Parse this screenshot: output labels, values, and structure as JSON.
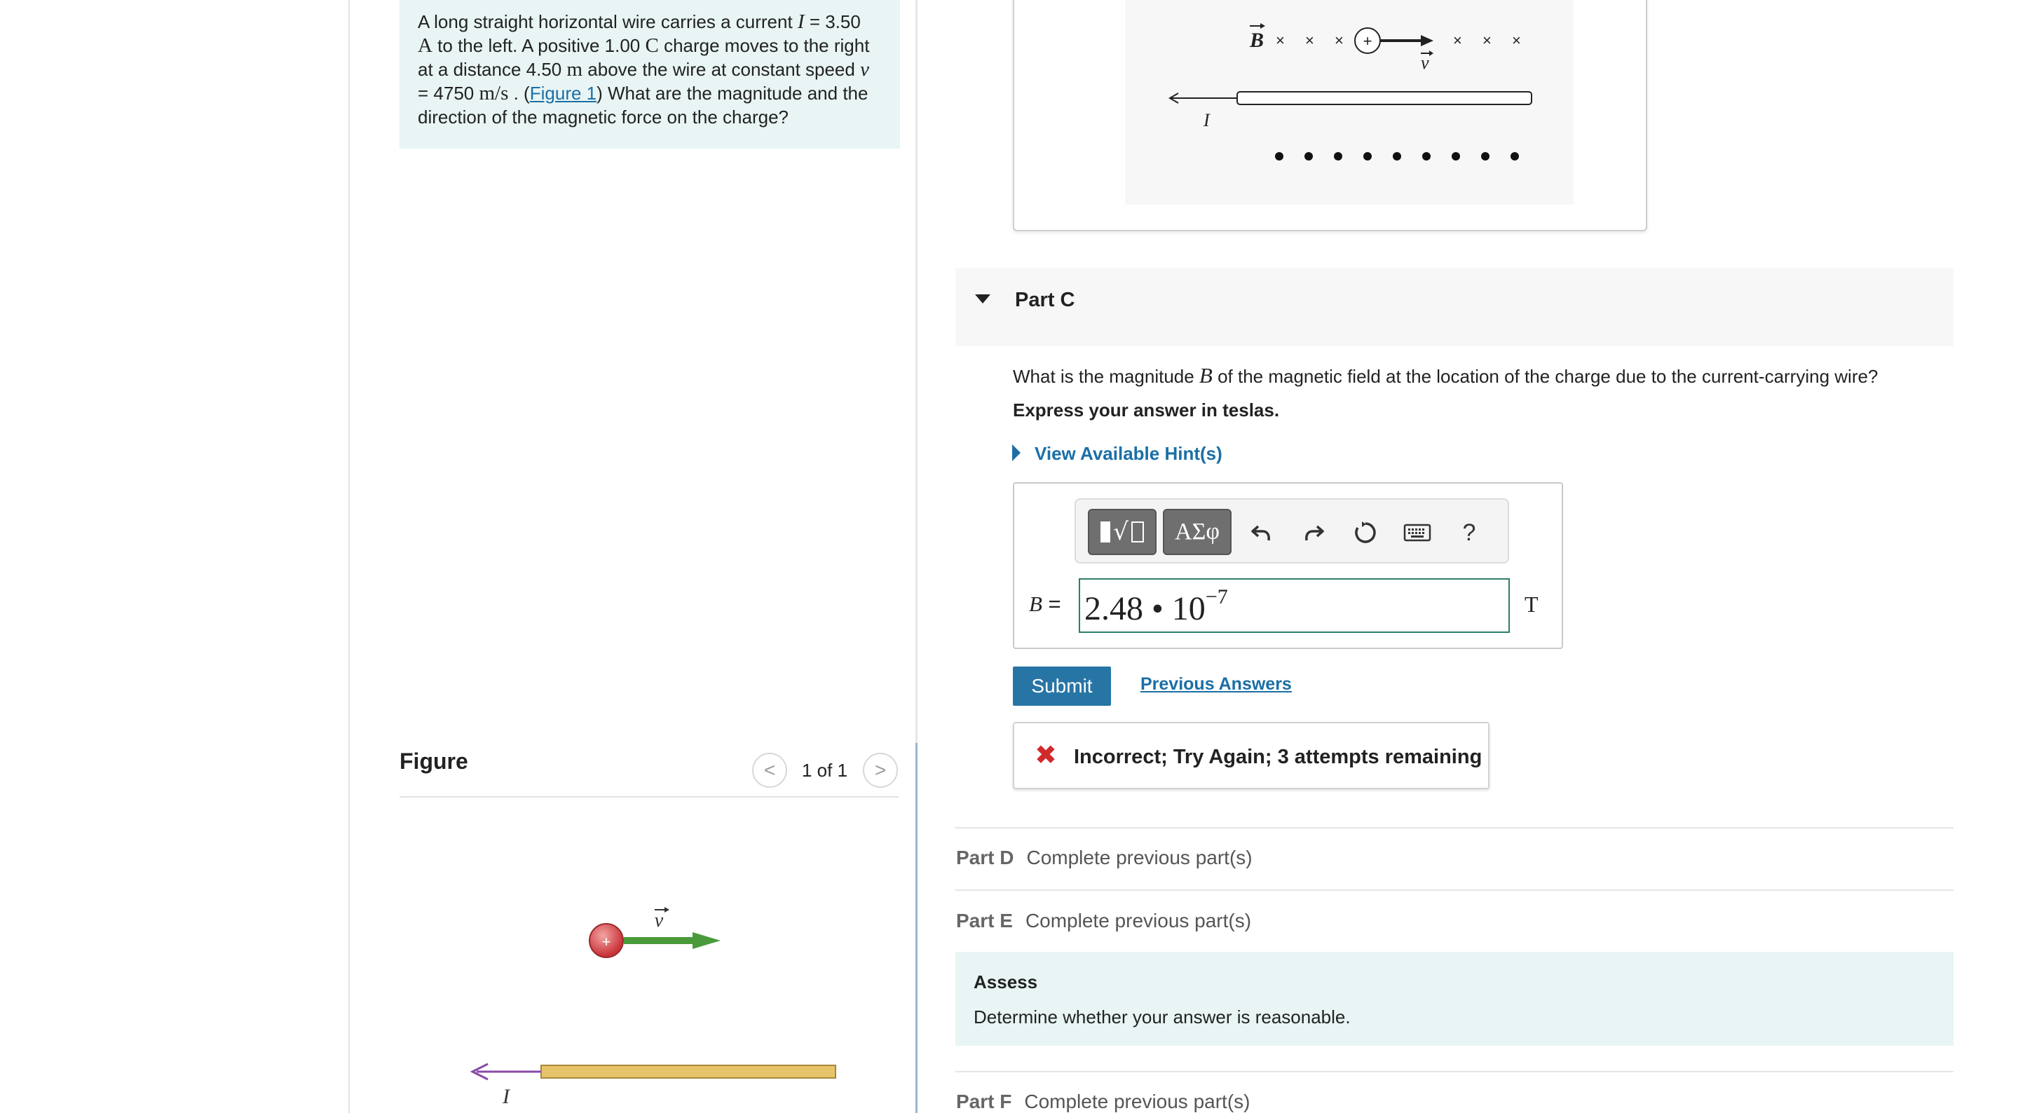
{
  "problem": {
    "t1": "A long straight horizontal wire carries a current ",
    "I_sym": "I",
    "t2": " = 3.50",
    "A_unit": "A",
    "t3": " to the left. A positive 1.00 ",
    "C_unit": "C",
    "t4": " charge moves to the right",
    "t5": "at a distance 4.50 ",
    "m_unit": "m",
    "t6": " above the wire at constant speed ",
    "v_sym": "v",
    "t7": "= 4750 ",
    "ms_unit": "m/s",
    "t8": " . (",
    "figure_link": "Figure 1",
    "t9": ") What are the magnitude and the",
    "t10": "direction of the magnetic force on the charge?"
  },
  "figure": {
    "title": "Figure",
    "prev": "<",
    "next": ">",
    "counter": "1 of 1",
    "current_label": "I",
    "velocity_label": "v",
    "charge_sign": "+",
    "field_label": "B",
    "cross_mark": "×",
    "colors": {
      "wire": "#e6c46a",
      "charge": "#d9534f",
      "velocity_arrow": "#4a9a3c",
      "current_arrow": "#8a4aa8"
    }
  },
  "partC": {
    "label": "Part C",
    "question_pre": "What is the magnitude ",
    "question_sym": "B",
    "question_post": " of the magnetic field at the location of the charge due to the current-carrying wire?",
    "express": "Express your answer in teslas.",
    "hint": "View Available Hint(s)",
    "toolbar": {
      "symbols_label": "ΑΣφ",
      "help_label": "?",
      "icons": [
        "templates-icon",
        "greek-symbols-icon",
        "undo-icon",
        "redo-icon",
        "reset-icon",
        "keyboard-icon",
        "help-icon"
      ]
    },
    "variable": "B",
    "equals": " =",
    "answer_mantissa": "2.48 • 10",
    "answer_exponent": "−7",
    "unit": "T",
    "submit": "Submit",
    "previous_answers": "Previous Answers",
    "feedback_icon": "✖",
    "feedback": "Incorrect; Try Again; 3 attempts remaining"
  },
  "partD": {
    "label": "Part D",
    "status": "Complete previous part(s)"
  },
  "partE": {
    "label": "Part E",
    "status": "Complete previous part(s)"
  },
  "assess": {
    "title": "Assess",
    "text": "Determine whether your answer is reasonable."
  },
  "partF": {
    "label": "Part F",
    "status": "Complete previous part(s)"
  },
  "colors": {
    "link": "#1b6fa6",
    "submit": "#2775a5",
    "problem_bg": "#e8f5f4",
    "error": "#d12a2a"
  }
}
